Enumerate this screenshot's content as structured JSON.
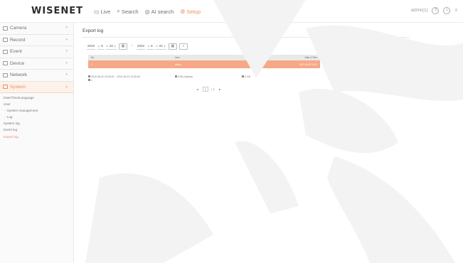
{
  "brand": {
    "logo": "WISENET"
  },
  "topnav": [
    {
      "label": "Live",
      "icon": "monitor-icon",
      "active": false
    },
    {
      "label": "Search",
      "icon": "search-icon",
      "active": false
    },
    {
      "label": "AI search",
      "icon": "ai-search-icon",
      "active": false
    },
    {
      "label": "Setup",
      "icon": "gear-icon",
      "active": true
    }
  ],
  "topright": {
    "user": "admin(1)",
    "help_label": "?",
    "info_label": "i",
    "menu_label": "≡"
  },
  "sidebar": {
    "items": [
      {
        "label": "Camera",
        "icon": "camera-icon",
        "active": false
      },
      {
        "label": "Record",
        "icon": "record-icon",
        "active": false
      },
      {
        "label": "Event",
        "icon": "event-icon",
        "active": false
      },
      {
        "label": "Device",
        "icon": "device-icon",
        "active": false
      },
      {
        "label": "Network",
        "icon": "network-icon",
        "active": false
      },
      {
        "label": "System",
        "icon": "system-icon",
        "active": true
      }
    ],
    "submenu": [
      {
        "label": "Date/Time/Language",
        "indent": false,
        "active": false
      },
      {
        "label": "User",
        "indent": false,
        "active": false
      },
      {
        "label": "- System management",
        "indent": true,
        "active": false
      },
      {
        "label": "- Log",
        "indent": true,
        "active": false
      },
      {
        "label": "System log",
        "indent": false,
        "active": false
      },
      {
        "label": "Event log",
        "indent": false,
        "active": false
      },
      {
        "label": "Export log",
        "indent": false,
        "active": true
      }
    ]
  },
  "main": {
    "title": "Export log",
    "filter": {
      "start_year": "2022",
      "start_month": "6",
      "start_day": "22",
      "end_year": "2022",
      "end_month": "6",
      "end_day": "22",
      "separator": "~"
    },
    "table": {
      "headers": [
        "No.",
        "User",
        "Date & Time"
      ],
      "rows": [
        {
          "no": "1",
          "user": "admin",
          "datetime": "2022-06-22 14:21"
        }
      ]
    },
    "detail": {
      "range": "2022-06-22 10:00:00 ~ 2022-06-22 12:00:00",
      "file": "SSM_Backup",
      "size": "4 GB",
      "channel": "1"
    },
    "pager": {
      "current": "1",
      "total": "/ 1"
    }
  }
}
